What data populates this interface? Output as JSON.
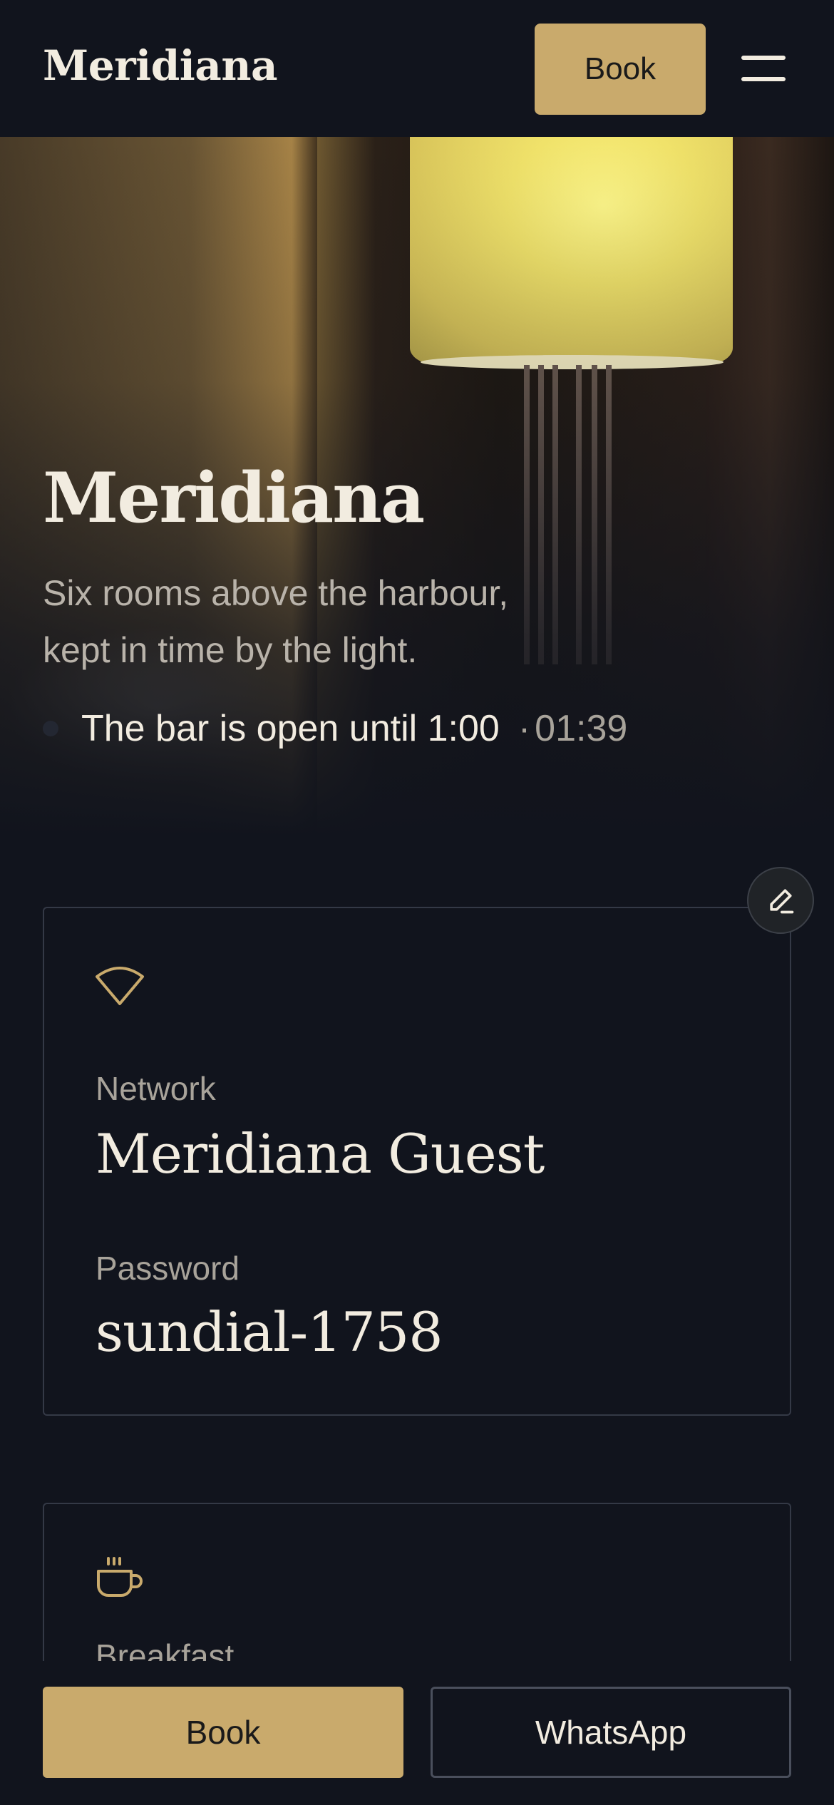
{
  "header": {
    "brand": "Meridiana",
    "book_label": "Book",
    "menu_icon": "hamburger-menu-icon"
  },
  "hero": {
    "title": "Meridiana",
    "subtitle": "Six rooms above the harbour, kept in time by the light.",
    "status_text": "The bar is open until 1:00",
    "status_separator": "·",
    "status_time": "01:39"
  },
  "edit": {
    "icon": "pencil-icon"
  },
  "wifi_card": {
    "icon": "wifi-icon",
    "network_label": "Network",
    "network_value": "Meridiana Guest",
    "password_label": "Password",
    "password_value": "sundial-1758"
  },
  "breakfast_card": {
    "icon": "coffee-cup-icon",
    "label": "Breakfast"
  },
  "bottom_bar": {
    "book_label": "Book",
    "whatsapp_label": "WhatsApp"
  },
  "colors": {
    "background": "#11141d",
    "accent_gold": "#c9aa6c",
    "text_light": "#f2ece0",
    "text_muted": "#a8a39a",
    "border": "#343946"
  }
}
